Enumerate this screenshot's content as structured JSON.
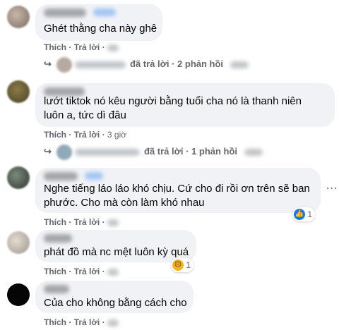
{
  "comments": [
    {
      "text_lines": [
        "Ghét thằng cha này ghê"
      ],
      "like_label": "Thích",
      "reply_label": "Trả lời",
      "time": "",
      "replies": {
        "summary": "đã trả lời · 2 phản hồi"
      }
    },
    {
      "text_lines": [
        "lướt tiktok nó kêu người bằng tuổi cha nó là thanh niên",
        "luôn a, tức dì đâu"
      ],
      "like_label": "Thích",
      "reply_label": "Trả lời",
      "time": "3 giờ",
      "replies": {
        "summary": "đã trả lời · 1 phản hồi"
      }
    },
    {
      "text_lines": [
        "Nghe tiếng láo láo khó chịu. Cứ cho đi rồi ơn trên sẽ ban",
        "phước. Cho mà còn làm khó nhau"
      ],
      "like_label": "Thích",
      "reply_label": "Trả lời",
      "time": "",
      "reaction": {
        "type": "like-icon",
        "count": "1",
        "color": "#1877f2"
      }
    },
    {
      "text_lines": [
        "phát đồ mà nc mệt luôn kỳ quá"
      ],
      "like_label": "Thích",
      "reply_label": "Trả lời",
      "time": "",
      "reaction": {
        "type": "sad-icon",
        "count": "1",
        "color": "#f7b125"
      }
    },
    {
      "text_lines": [
        "Của cho không bằng cách cho"
      ],
      "like_label": "Thích",
      "reply_label": "Trả lời",
      "time": ""
    }
  ],
  "colors": {
    "bubble": "#f0f2f5",
    "meta_text": "#65676b",
    "accent": "#1877f2"
  },
  "icons": {
    "more": "more-options-icon",
    "reply_arrow": "reply-arrow-icon"
  }
}
